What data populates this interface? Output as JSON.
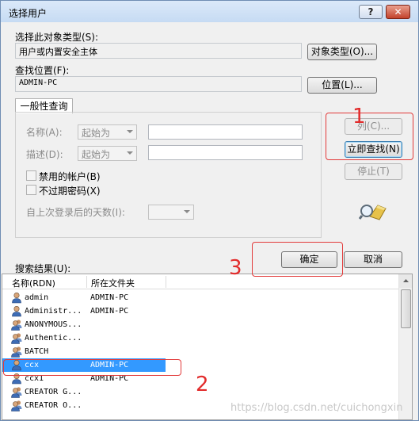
{
  "window": {
    "title": "选择用户",
    "help_label": "?",
    "close_label": "✕"
  },
  "object_type": {
    "label": "选择此对象类型(S):",
    "value": "用户或内置安全主体",
    "button": "对象类型(O)..."
  },
  "location": {
    "label": "查找位置(F):",
    "value": "ADMIN-PC",
    "button": "位置(L)..."
  },
  "general_query": {
    "tab": "一般性查询",
    "name_label": "名称(A):",
    "name_combo": "起始为",
    "desc_label": "描述(D):",
    "desc_combo": "起始为",
    "disabled_accounts": "禁用的帐户(B)",
    "no_expire_password": "不过期密码(X)",
    "days_since_logon": "自上次登录后的天数(I):"
  },
  "buttons": {
    "columns": "列(C)...",
    "find_now": "立即查找(N)",
    "stop": "停止(T)",
    "ok": "确定",
    "cancel": "取消"
  },
  "results": {
    "label": "搜索结果(U):",
    "columns": [
      "名称(RDN)",
      "所在文件夹"
    ],
    "rows": [
      {
        "name": "admin",
        "folder": "ADMIN-PC",
        "icon": "user-icon"
      },
      {
        "name": "Administr...",
        "folder": "ADMIN-PC",
        "icon": "user-icon"
      },
      {
        "name": "ANONYMOUS...",
        "folder": "",
        "icon": "group-icon"
      },
      {
        "name": "Authentic...",
        "folder": "",
        "icon": "group-icon"
      },
      {
        "name": "BATCH",
        "folder": "",
        "icon": "group-icon"
      },
      {
        "name": "ccx",
        "folder": "ADMIN-PC",
        "icon": "user-icon",
        "selected": true
      },
      {
        "name": "ccx1",
        "folder": "ADMIN-PC",
        "icon": "user-icon"
      },
      {
        "name": "CREATOR G...",
        "folder": "",
        "icon": "group-icon"
      },
      {
        "name": "CREATOR O...",
        "folder": "",
        "icon": "group-icon"
      }
    ]
  },
  "annotations": {
    "n1": "1",
    "n2": "2",
    "n3": "3"
  },
  "watermark": "https://blog.csdn.net/cuichongxin",
  "colors": {
    "annotation_red": "#e23a3a",
    "selection_blue": "#3399ff"
  }
}
